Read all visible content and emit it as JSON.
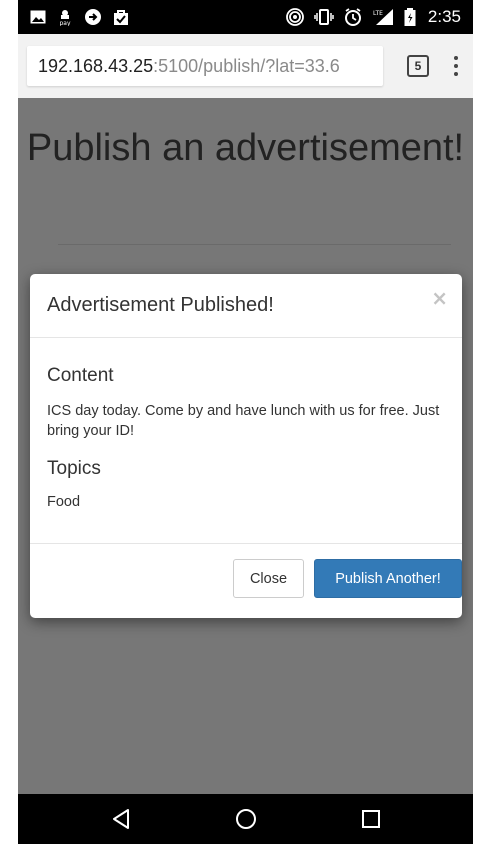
{
  "status_bar": {
    "time": "2:35",
    "icons_left": [
      "image-icon",
      "android-pay-icon",
      "redirect-icon",
      "shopping-bag-icon"
    ],
    "icons_right": [
      "hotspot-icon",
      "vibrate-icon",
      "alarm-icon",
      "lte-signal-icon",
      "battery-icon"
    ]
  },
  "browser": {
    "url_host": "192.168.43.25",
    "url_rest": ":5100/publish/?lat=33.6",
    "tab_count": "5"
  },
  "page": {
    "title": "Publish an advertisement!"
  },
  "modal": {
    "title": "Advertisement Published!",
    "close_symbol": "×",
    "content_heading": "Content",
    "content_text": "ICS day today. Come by and have lunch with us for free. Just bring your ID!",
    "topics_heading": "Topics",
    "topics_text": "Food",
    "close_label": "Close",
    "publish_another_label": "Publish Another!"
  },
  "colors": {
    "primary": "#337ab7",
    "overlay_bg": "#777777",
    "status_bar": "#000000"
  }
}
